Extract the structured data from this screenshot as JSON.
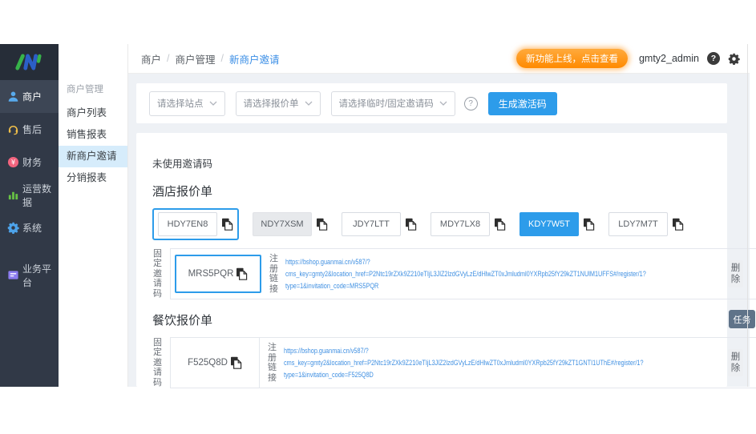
{
  "sidebar": {
    "items": [
      {
        "label": "商户"
      },
      {
        "label": "售后"
      },
      {
        "label": "财务"
      },
      {
        "label": "运营数据"
      },
      {
        "label": "系统"
      },
      {
        "label": "业务平台"
      }
    ]
  },
  "submenu": {
    "header": "商户管理",
    "items": [
      "商户列表",
      "销售报表",
      "新商户邀请",
      "分销报表"
    ]
  },
  "topbar": {
    "breadcrumb": [
      "商户",
      "商户管理",
      "新商户邀请"
    ],
    "sep": "/",
    "badge": "新功能上线，点击查看",
    "username": "gmty2_admin"
  },
  "icons": {
    "question": "?"
  },
  "filters": {
    "site": "请选择站点",
    "quote": "请选择报价单",
    "type": "请选择临时/固定邀请码",
    "generate": "生成激活码"
  },
  "unused_title": "未使用邀请码",
  "hotel": {
    "title": "酒店报价单",
    "chips": [
      {
        "code": "HDY7EN8"
      },
      {
        "code": "NDY7XSM"
      },
      {
        "code": "JDY7LTT"
      },
      {
        "code": "MDY7LX8"
      },
      {
        "code": "KDY7W5T"
      },
      {
        "code": "LDY7M7T"
      }
    ],
    "fixed_label": "固定邀请码",
    "code": "MRS5PQR",
    "link_label": "注册链接",
    "url1": "https://bshop.guanmai.cn/v587/?",
    "url2": "cms_key=gmty2&location_href=P2Ntc19rZXk9Z210eTIjL3JlZ2lzdGVyLzE/dHlwZT0xJmludml0YXRpb25fY29kZT1NUlM1UFFS#/register/1?",
    "url3": "type=1&invitation_code=MRS5PQR",
    "delete": "删除"
  },
  "catering": {
    "title": "餐饮报价单",
    "fixed_label": "固定邀请码",
    "code": "F525Q8D",
    "link_label": "注册链接",
    "url1": "https://bshop.guanmai.cn/v587/?",
    "url2": "cms_key=gmty2&location_href=P2Ntc19rZXk9Z210eTIjL3JlZ2lzdGVyLzE/dHlwZT0xJmludml0YXRpb25fY29kZT1GNTI1UThE#/register/1?",
    "url3": "type=1&invitation_code=F525Q8D",
    "delete": "删除"
  },
  "task_tab": "任务",
  "colors": {
    "accent": "#2d9cea",
    "badge_orange": "#ff8a00",
    "sidebar_dark": "#313947",
    "submenu_selected": "#d6ecfb",
    "link_blue": "#4090e2",
    "task_tab_slate": "#5f7389"
  }
}
